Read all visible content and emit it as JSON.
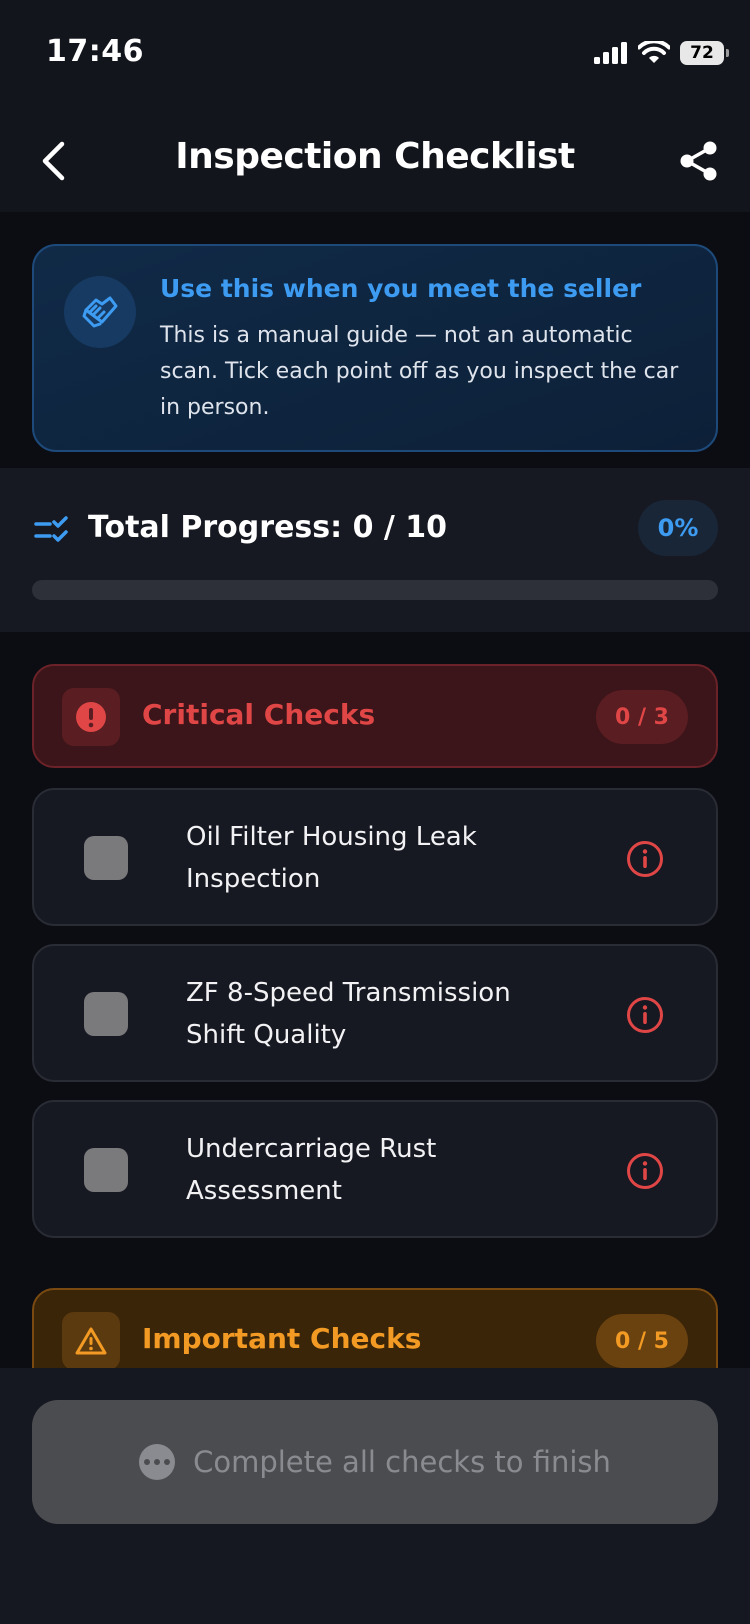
{
  "status_bar": {
    "time": "17:46",
    "battery": "72"
  },
  "nav": {
    "title": "Inspection Checklist"
  },
  "info_card": {
    "title": "Use this when you meet the seller",
    "body": "This is a manual guide — not an automatic scan. Tick each point off as you inspect the car in person."
  },
  "progress": {
    "label": "Total Progress: 0 / 10",
    "percent_label": "0%",
    "fraction": 0
  },
  "groups": [
    {
      "title": "Critical Checks",
      "count": "0 / 3",
      "color": "#e04646",
      "items": [
        {
          "label": "Oil Filter Housing Leak Inspection",
          "checked": false
        },
        {
          "label": "ZF 8-Speed Transmission Shift Quality",
          "checked": false
        },
        {
          "label": "Undercarriage Rust Assessment",
          "checked": false
        }
      ]
    },
    {
      "title": "Important Checks",
      "count": "0 / 5",
      "color": "#f29a23"
    }
  ],
  "finish_button": {
    "label": "Complete all checks to finish"
  },
  "colors": {
    "accent": "#3d9cf2",
    "critical": "#e04646",
    "important": "#f29a23"
  }
}
